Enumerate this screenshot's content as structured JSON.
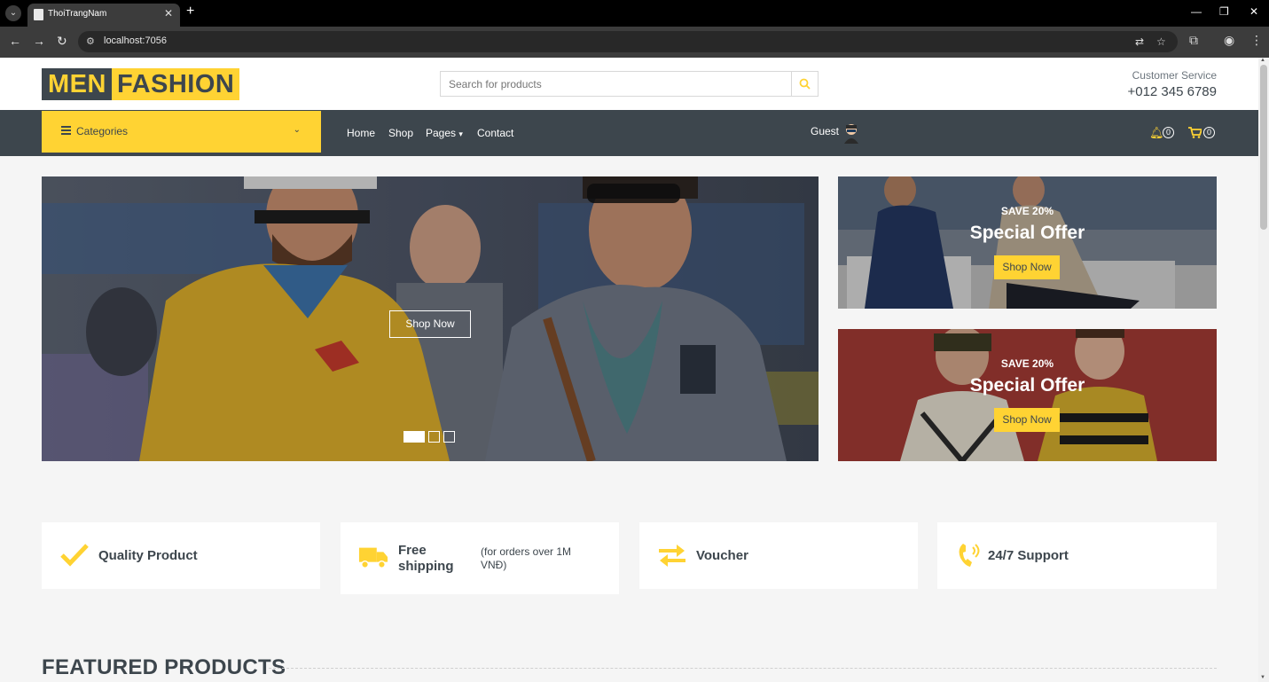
{
  "browser": {
    "tab_title": "ThoiTrangNam",
    "url": "localhost:7056"
  },
  "header": {
    "logo_part1": "MEN",
    "logo_part2": "FASHION",
    "search_placeholder": "Search for products",
    "service_label": "Customer Service",
    "service_phone": "+012 345 6789"
  },
  "nav": {
    "categories_label": "Categories",
    "links": [
      "Home",
      "Shop",
      "Pages",
      "Contact"
    ],
    "user": "Guest",
    "notifications_count": "0",
    "cart_count": "0"
  },
  "carousel": {
    "button_label": "Shop Now",
    "slide_count": 3,
    "active_slide": 1
  },
  "offers": [
    {
      "save": "SAVE 20%",
      "title": "Special Offer",
      "button": "Shop Now"
    },
    {
      "save": "SAVE 20%",
      "title": "Special Offer",
      "button": "Shop Now"
    }
  ],
  "features": [
    {
      "title": "Quality Product",
      "icon": "check-icon"
    },
    {
      "title_line1": "Free",
      "title_line2": "shipping",
      "sub_line1": "(for orders over 1M",
      "sub_line2": "VNĐ)",
      "icon": "truck-icon"
    },
    {
      "title": "Voucher",
      "icon": "exchange-icon"
    },
    {
      "title": "24/7 Support",
      "icon": "phone-volume-icon"
    }
  ],
  "section": {
    "title": "FEATURED PRODUCTS"
  },
  "colors": {
    "primary": "#ffd333",
    "dark": "#3d464d",
    "light_bg": "#f5f5f5"
  }
}
